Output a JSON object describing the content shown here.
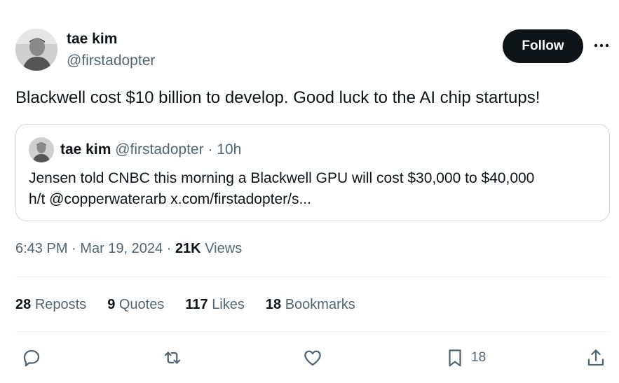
{
  "author": {
    "name": "tae kim",
    "handle": "@firstadopter",
    "follow_label": "Follow"
  },
  "tweet": {
    "text": "Blackwell cost $10 billion to develop. Good luck to the AI chip startups!"
  },
  "quote": {
    "name": "tae kim",
    "handle": "@firstadopter",
    "separator": "·",
    "time": "10h",
    "text_line1": "Jensen told CNBC this morning a Blackwell GPU will cost $30,000 to $40,000",
    "text_line2": "h/t @copperwaterarb x.com/firstadopter/s..."
  },
  "meta": {
    "time": "6:43 PM",
    "sep1": "·",
    "date": "Mar 19, 2024",
    "sep2": "·",
    "views_count": "21K",
    "views_label": "Views"
  },
  "stats": {
    "reposts_count": "28",
    "reposts_label": "Reposts",
    "quotes_count": "9",
    "quotes_label": "Quotes",
    "likes_count": "117",
    "likes_label": "Likes",
    "bookmarks_count": "18",
    "bookmarks_label": "Bookmarks"
  },
  "actions": {
    "bookmark_count": "18"
  },
  "icons": [
    "reply-icon",
    "repost-icon",
    "like-icon",
    "bookmark-icon",
    "share-icon",
    "more-icon"
  ],
  "colors": {
    "text": "#0f1419",
    "secondary": "#536471",
    "border": "#cfd9de",
    "follow_bg": "#0f1419"
  }
}
